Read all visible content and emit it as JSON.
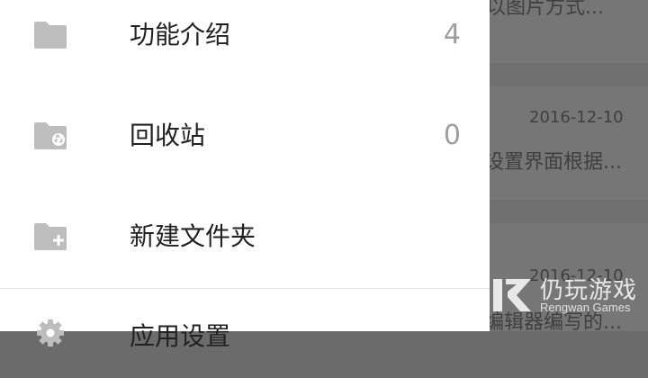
{
  "background": {
    "note_1_text": "以图片方式...",
    "note_2_date": "2016-12-10",
    "note_2_text": "设置界面根据...",
    "note_3_date": "2016-12-10",
    "note_3_text": "编辑器编写的..."
  },
  "drawer": {
    "items": [
      {
        "label": "功能介绍",
        "count": "4",
        "icon": "folder-icon"
      },
      {
        "label": "回收站",
        "count": "0",
        "icon": "recycle-folder-icon"
      },
      {
        "label": "新建文件夹",
        "count": "",
        "icon": "new-folder-icon"
      },
      {
        "label": "应用设置",
        "count": "",
        "icon": "gear-icon"
      }
    ]
  },
  "watermark": {
    "title": "仍玩游戏",
    "subtitle": "Rengwan Games"
  },
  "colors": {
    "drawer_bg": "#ffffff",
    "icon_gray": "#bdbdbd",
    "label_text": "#212121",
    "count_text": "#9e9e9e",
    "scrim": "#6f6f6f"
  }
}
